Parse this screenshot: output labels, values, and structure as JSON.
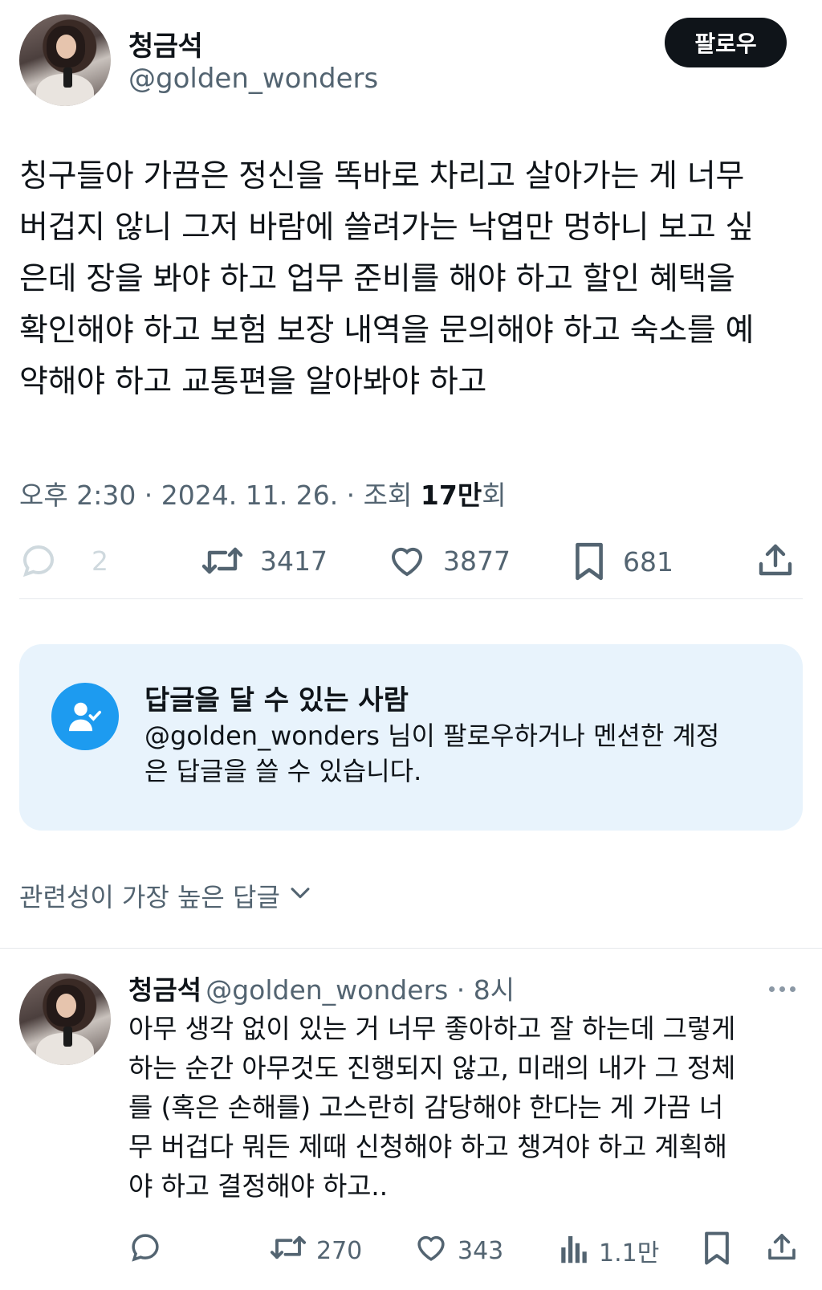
{
  "tweet": {
    "author": {
      "name": "청금석",
      "handle": "@golden_wonders"
    },
    "follow_label": "팔로우",
    "text_lines": [
      "칭구들아 가끔은 정신을 똑바로 차리고 살아가는 게 너무",
      "버겁지 않니 그저 바람에 쓸려가는 낙엽만 멍하니 보고 싶",
      "은데 장을 봐야 하고 업무 준비를 해야 하고 할인 혜택을",
      "확인해야 하고 보험 보장 내역을 문의해야 하고 숙소를 예",
      "약해야 하고 교통편을 알아봐야 하고"
    ],
    "meta": {
      "time": "오후 2:30 · 2024. 11. 26. · 조회 ",
      "views": "17만",
      "views_suffix": "회"
    },
    "stats": {
      "replies": "2",
      "retweets": "3417",
      "likes": "3877",
      "bookmarks": "681"
    }
  },
  "reply_permission": {
    "title": "답글을 달 수 있는 사람",
    "description_line1": "@golden_wonders 님이 팔로우하거나 멘션한 계정",
    "description_line2": "은 답글을 쓸 수 있습니다."
  },
  "sort_label": "관련성이 가장 높은 답글",
  "reply": {
    "name": "청금석",
    "handle_time": "@golden_wonders · 8시",
    "text_lines": [
      "아무 생각 없이 있는 거 너무 좋아하고 잘 하는데 그렇게",
      "하는 순간 아무것도 진행되지 않고, 미래의 내가 그 정체",
      "를 (혹은 손해를) 고스란히 감당해야 한다는 게 가끔 너",
      "무 버겁다 뭐든 제때 신청해야 하고 챙겨야 하고 계획해",
      "야 하고 결정해야 하고.."
    ],
    "stats": {
      "retweets": "270",
      "likes": "343",
      "views": "1.1만"
    }
  },
  "colors": {
    "accent": "#1d9bf0",
    "text": "#0f1419",
    "muted": "#536471",
    "reply_box_bg": "#e8f3fc"
  }
}
